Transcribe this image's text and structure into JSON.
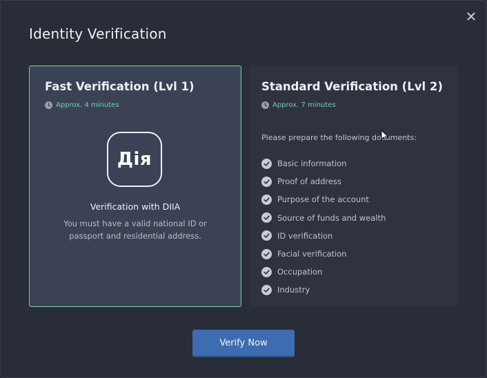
{
  "modal": {
    "title": "Identity Verification",
    "close_symbol": "✕"
  },
  "fast_card": {
    "title": "Fast Verification (Lvl 1)",
    "time": "Approx. 4 minutes",
    "logo_text": "Дія",
    "heading": "Verification with DIIA",
    "description": "You must have a valid national ID or passport and residential address.",
    "selected": true
  },
  "standard_card": {
    "title": "Standard Verification (Lvl 2)",
    "time": "Approx. 7 minutes",
    "prepare_text": "Please prepare the following documents:",
    "documents": [
      "Basic information",
      "Proof of address",
      "Purpose of the account",
      "Source of funds and wealth",
      "ID verification",
      "Facial verification",
      "Occupation",
      "Industry"
    ]
  },
  "footer": {
    "verify_label": "Verify Now"
  },
  "colors": {
    "accent_green": "#71d2a4",
    "selected_border": "#7fd0b0",
    "button_blue": "#3e6cb0",
    "check_gray": "#c9ccd2"
  }
}
